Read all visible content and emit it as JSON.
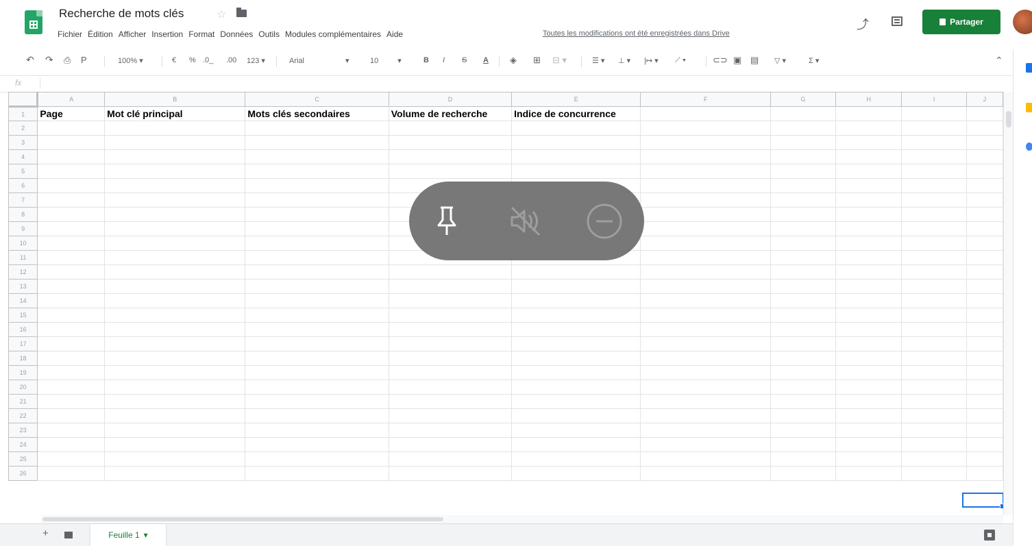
{
  "header": {
    "title": "Recherche de mots clés",
    "menus": [
      "Fichier",
      "Édition",
      "Afficher",
      "Insertion",
      "Format",
      "Données",
      "Outils",
      "Modules complémentaires",
      "Aide"
    ],
    "save_status": "Toutes les modifications ont été enregistrées dans Drive",
    "share_label": "Partager"
  },
  "toolbar": {
    "zoom": "100%",
    "currency": "€",
    "percent": "%",
    "decimal_decrease": ".0_",
    "decimal_increase": ".00",
    "more_formats": "123",
    "font": "Arial",
    "font_size": "10",
    "bold": "B",
    "italic": "I",
    "strike": "S",
    "text_color": "A",
    "functions": "Σ"
  },
  "formula": {
    "icon": "fx"
  },
  "sheet": {
    "columns": [
      "A",
      "B",
      "C",
      "D",
      "E",
      "F",
      "G",
      "H",
      "I",
      "J"
    ],
    "headers": [
      "Page",
      "Mot clé principal",
      "Mots clés secondaires",
      "Volume de recherche",
      "Indice de concurrence"
    ],
    "rows": [
      "1",
      "2",
      "3",
      "4",
      "5",
      "6",
      "7",
      "8",
      "9",
      "10",
      "11",
      "12",
      "13",
      "14",
      "15",
      "16",
      "17",
      "18",
      "19",
      "20",
      "21",
      "22",
      "23",
      "24",
      "25",
      "26"
    ]
  },
  "tabs": {
    "active": "Feuille 1"
  },
  "colors": {
    "brand_green": "#188038",
    "logo_green": "#23a566",
    "selection": "#1a73e8",
    "overlay": "#6e6e6e"
  },
  "icons": {
    "overlay": [
      "pin-icon",
      "mute-icon",
      "minus-circle-icon"
    ],
    "side_panel": [
      "calendar-icon",
      "keep-icon",
      "tasks-icon"
    ]
  }
}
